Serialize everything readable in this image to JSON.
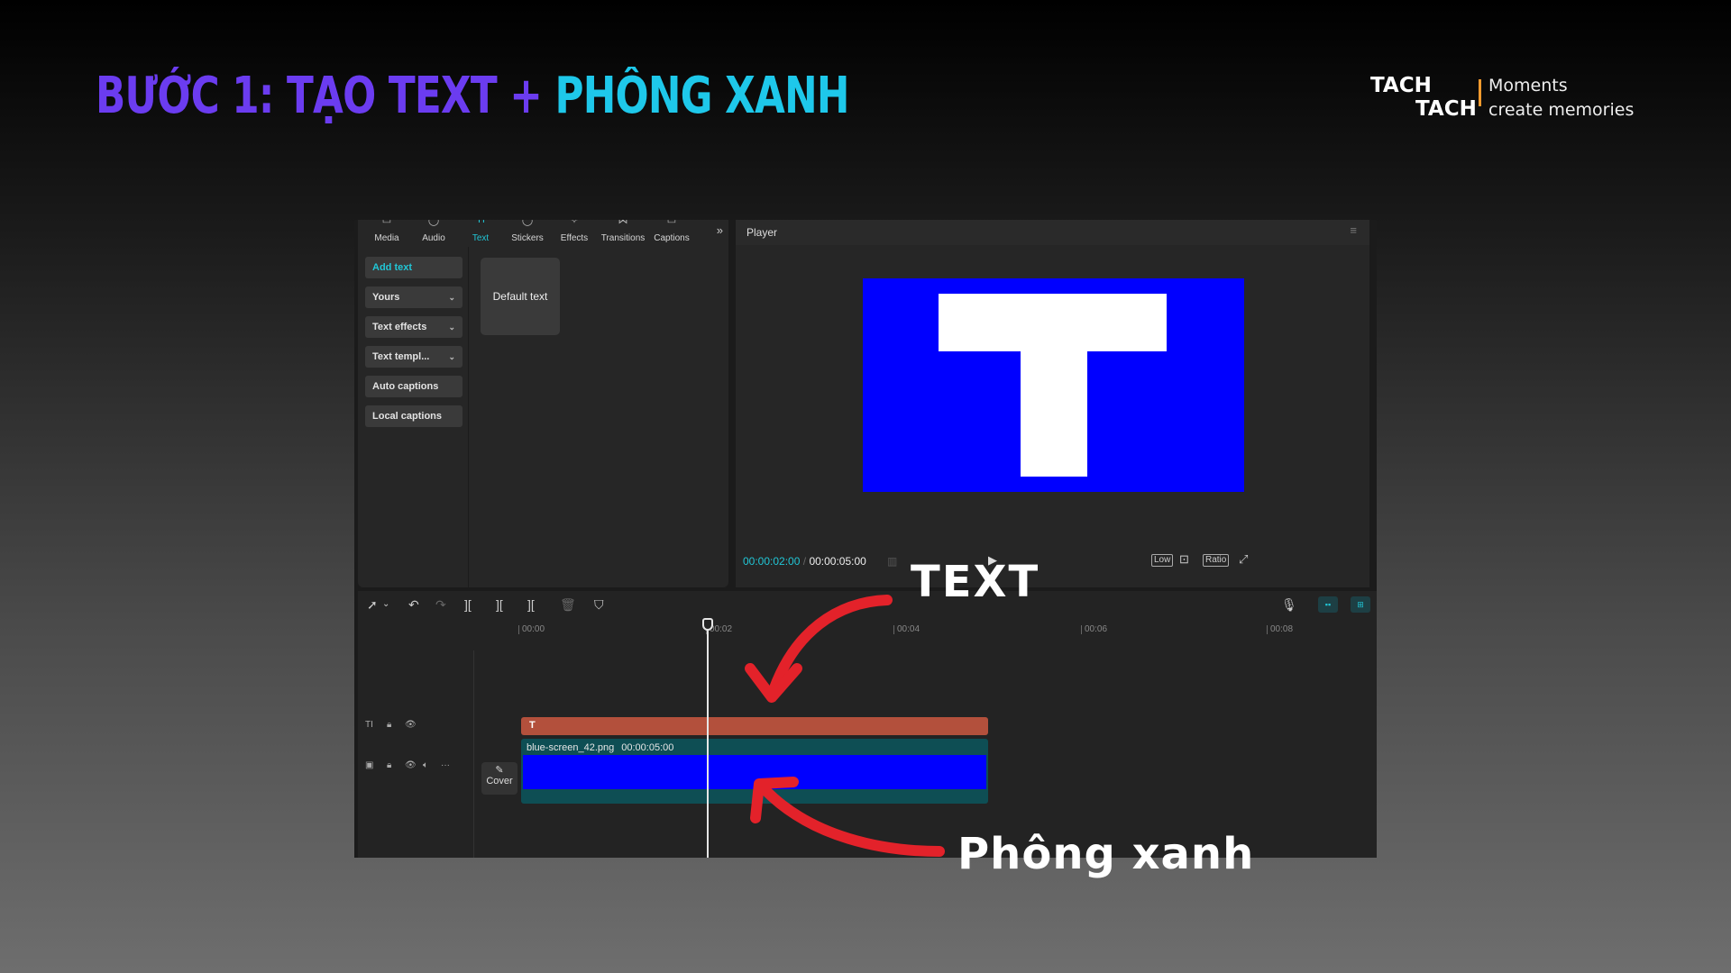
{
  "slide": {
    "title_part1": "BƯỚC 1: TẠO TEXT + ",
    "title_part2": "PHÔNG XANH",
    "title_color1": "#6b3cf0",
    "title_color2": "#1ec8ea",
    "brand_line1": "TACH",
    "brand_line2": "TACH",
    "tagline_line1": "Moments",
    "tagline_line2": "create memories",
    "brand_accent": "#f29a2e"
  },
  "toolbar": {
    "tabs": [
      {
        "label": "Media",
        "icon": "media-icon"
      },
      {
        "label": "Audio",
        "icon": "audio-icon"
      },
      {
        "label": "Text",
        "icon": "text-icon",
        "active": true
      },
      {
        "label": "Stickers",
        "icon": "stickers-icon"
      },
      {
        "label": "Effects",
        "icon": "effects-icon"
      },
      {
        "label": "Transitions",
        "icon": "transitions-icon"
      },
      {
        "label": "Captions",
        "icon": "captions-icon"
      }
    ],
    "more_label": "»"
  },
  "text_panel": {
    "nav": [
      {
        "label": "Add text",
        "active": true
      },
      {
        "label": "Yours",
        "chevron": "⌄"
      },
      {
        "label": "Text effects",
        "chevron": "⌄"
      },
      {
        "label": "Text templ...",
        "chevron": "⌄"
      },
      {
        "label": "Auto captions"
      },
      {
        "label": "Local captions"
      }
    ],
    "default_text_label": "Default text"
  },
  "player": {
    "title": "Player",
    "menu_icon": "≡",
    "preview_background": "#0000ff",
    "preview_letter": "T",
    "current_time": "00:00:02:00",
    "separator": "/",
    "total_time": "00:00:05:00",
    "controls": [
      "Low",
      "Ratio"
    ]
  },
  "timeline": {
    "ruler_labels": [
      "00:00",
      "00:02",
      "00:04",
      "00:06",
      "00:08"
    ],
    "text_clip_label": "T",
    "video_clip_name": "blue-screen_42.png",
    "video_clip_duration": "00:00:05:00",
    "cover_label": "Cover",
    "text_clip_color": "#b3503c",
    "video_clip_color": "#0e4e54"
  },
  "annotations": {
    "text_label": "TEXT",
    "green_screen_label": "Phông xanh",
    "arrow_color": "#e3222a"
  }
}
